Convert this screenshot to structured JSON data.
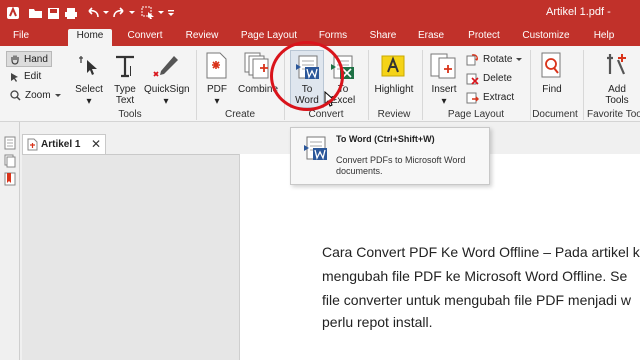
{
  "window": {
    "title": "Artikel 1.pdf -"
  },
  "quick_access": [
    "folder-icon",
    "save-icon",
    "print-icon",
    "undo-icon",
    "redo-icon",
    "select-icon",
    "customize-icon"
  ],
  "menu_tabs": [
    "File",
    "Home",
    "Convert",
    "Review",
    "Page Layout",
    "Forms",
    "Share",
    "Erase",
    "Protect",
    "Customize",
    "Help"
  ],
  "active_tab": "Home",
  "ribbon": {
    "hand": "Hand",
    "edit": "Edit",
    "zoom": "Zoom",
    "select": "Select",
    "type_line1": "Type",
    "type_line2": "Text",
    "quicksign": "QuickSign",
    "tools_group": "Tools",
    "pdf": "PDF",
    "combine": "Combine",
    "create_group": "Create",
    "to_word_line1": "To",
    "to_word_line2": "Word",
    "to_excel_line1": "To",
    "to_excel_line2": "Excel",
    "convert_group": "Convert",
    "highlight": "Highlight",
    "review_group": "Review",
    "insert": "Insert",
    "rotate": "Rotate",
    "delete": "Delete",
    "extract": "Extract",
    "page_layout_group": "Page Layout",
    "find": "Find",
    "document_group": "Document",
    "add_tools_line1": "Add",
    "add_tools_line2": "Tools",
    "favorite_group": "Favorite Too"
  },
  "doc_tab": {
    "label": "Artikel 1"
  },
  "tooltip": {
    "title": "To Word (Ctrl+Shift+W)",
    "description": "Convert PDFs to Microsoft Word documents."
  },
  "document_text": [
    "Cara Convert PDF Ke Word Offline – Pada artikel k",
    "mengubah file PDF ke Microsoft Word Offline. Se",
    "file converter untuk mengubah file PDF menjadi w",
    "perlu repot install."
  ],
  "colors": {
    "accent": "#c1312a",
    "annotation": "#d9141b"
  }
}
